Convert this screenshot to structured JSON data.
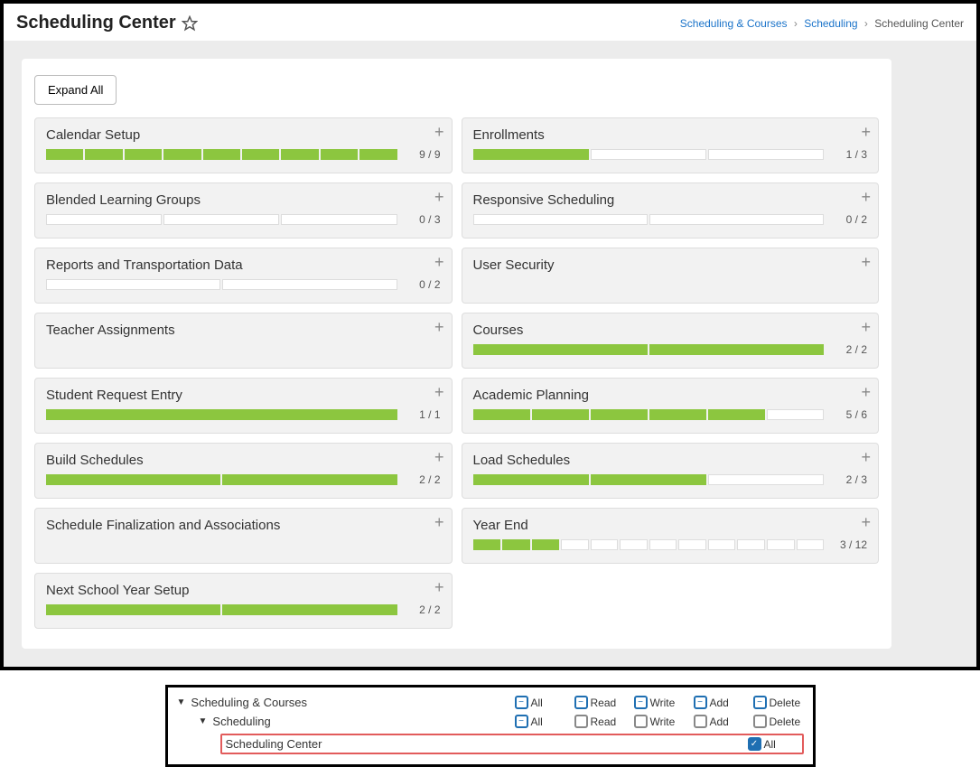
{
  "header": {
    "title": "Scheduling Center",
    "crumbs": {
      "root": "Scheduling & Courses",
      "mid": "Scheduling",
      "current": "Scheduling Center"
    }
  },
  "expand_label": "Expand All",
  "tiles": [
    {
      "title": "Calendar Setup",
      "done": 9,
      "total": 9
    },
    {
      "title": "Enrollments",
      "done": 1,
      "total": 3
    },
    {
      "title": "Blended Learning Groups",
      "done": 0,
      "total": 3
    },
    {
      "title": "Responsive Scheduling",
      "done": 0,
      "total": 2
    },
    {
      "title": "Reports and Transportation Data",
      "done": 0,
      "total": 2
    },
    {
      "title": "User Security",
      "done": null,
      "total": null
    },
    {
      "title": "Teacher Assignments",
      "done": null,
      "total": null
    },
    {
      "title": "Courses",
      "done": 2,
      "total": 2
    },
    {
      "title": "Student Request Entry",
      "done": 1,
      "total": 1
    },
    {
      "title": "Academic Planning",
      "done": 5,
      "total": 6
    },
    {
      "title": "Build Schedules",
      "done": 2,
      "total": 2
    },
    {
      "title": "Load Schedules",
      "done": 2,
      "total": 3
    },
    {
      "title": "Schedule Finalization and Associations",
      "done": null,
      "total": null
    },
    {
      "title": "Year End",
      "done": 3,
      "total": 12
    },
    {
      "title": "Next School Year Setup",
      "done": 2,
      "total": 2
    }
  ],
  "perms": {
    "cols": [
      "All",
      "Read",
      "Write",
      "Add",
      "Delete"
    ],
    "rows": [
      {
        "label": "Scheduling & Courses",
        "indent": 0,
        "arrow": true,
        "cb": [
          {
            "state": "minus"
          },
          {
            "state": "minus"
          },
          {
            "state": "minus"
          },
          {
            "state": "minus"
          },
          {
            "state": "minus"
          }
        ],
        "hl": false
      },
      {
        "label": "Scheduling",
        "indent": 1,
        "arrow": true,
        "cb": [
          {
            "state": "minus"
          },
          {
            "state": "plain"
          },
          {
            "state": "plain"
          },
          {
            "state": "plain"
          },
          {
            "state": "plain"
          }
        ],
        "hl": false
      },
      {
        "label": "Scheduling Center",
        "indent": 2,
        "arrow": false,
        "cb": [
          {
            "state": "checked"
          }
        ],
        "hl": true,
        "single_col": "All"
      }
    ]
  }
}
